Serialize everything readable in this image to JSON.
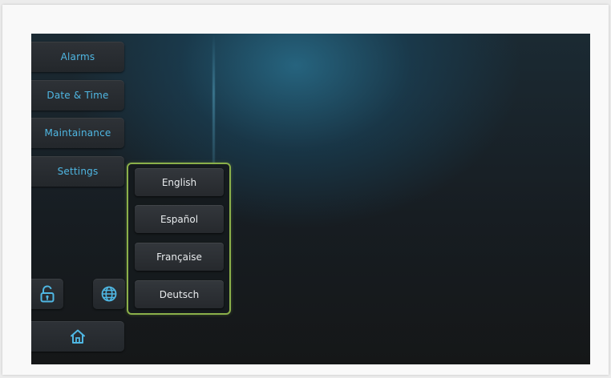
{
  "colors": {
    "accent": "#4fb7e3",
    "panel_border": "#8bb04a",
    "language_text": "#e9ecee"
  },
  "sidebar": {
    "items": [
      {
        "label": "Alarms"
      },
      {
        "label": "Date & Time"
      },
      {
        "label": "Maintainance"
      },
      {
        "label": "Settings"
      }
    ]
  },
  "language_menu": {
    "options": [
      {
        "label": "English"
      },
      {
        "label": "Español"
      },
      {
        "label": "Française"
      },
      {
        "label": "Deutsch"
      }
    ]
  },
  "bottom_controls": {
    "lock_icon": "unlock-icon",
    "language_icon": "globe-icon",
    "home_icon": "home-icon"
  }
}
